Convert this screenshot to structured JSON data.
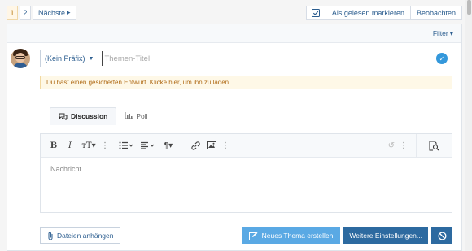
{
  "pagination": {
    "pages": [
      "1",
      "2"
    ],
    "current": "1",
    "next_label": "Nächste",
    "next_icon": "chevron-right-icon"
  },
  "top_actions": {
    "check_icon": "checkbox-icon",
    "mark_read_label": "Als gelesen markieren",
    "watch_label": "Beobachten"
  },
  "filter": {
    "label": "Filter",
    "icon": "caret-down-icon"
  },
  "composer": {
    "prefix_label": "(Kein Präfix)",
    "title_placeholder": "Themen-Titel",
    "title_value": "",
    "draft_notice": "Du hast einen gesicherten Entwurf. Klicke hier, um ihn zu laden."
  },
  "tabs": [
    {
      "label": "Discussion",
      "icon": "comments-icon",
      "active": true
    },
    {
      "label": "Poll",
      "icon": "bar-chart-icon",
      "active": false
    }
  ],
  "editor": {
    "message_placeholder": "Nachricht...",
    "toolbar_icons": [
      "bold-icon",
      "italic-icon",
      "text-size-icon",
      "more-icon",
      "list-icon",
      "align-icon",
      "paragraph-icon",
      "link-icon",
      "image-icon",
      "more-icon",
      "undo-icon",
      "more-icon",
      "preview-icon"
    ]
  },
  "bottom": {
    "attach_label": "Dateien anhängen",
    "create_label": "Neues Thema erstellen",
    "more_options_label": "Weitere Einstellungen...",
    "cancel_icon": "ban-icon"
  },
  "colors": {
    "link": "#2b5d8f",
    "primary": "#5aa9e4",
    "secondary": "#2d6aa0",
    "notice_bg": "#fef8e7",
    "notice_text": "#b06b17"
  }
}
